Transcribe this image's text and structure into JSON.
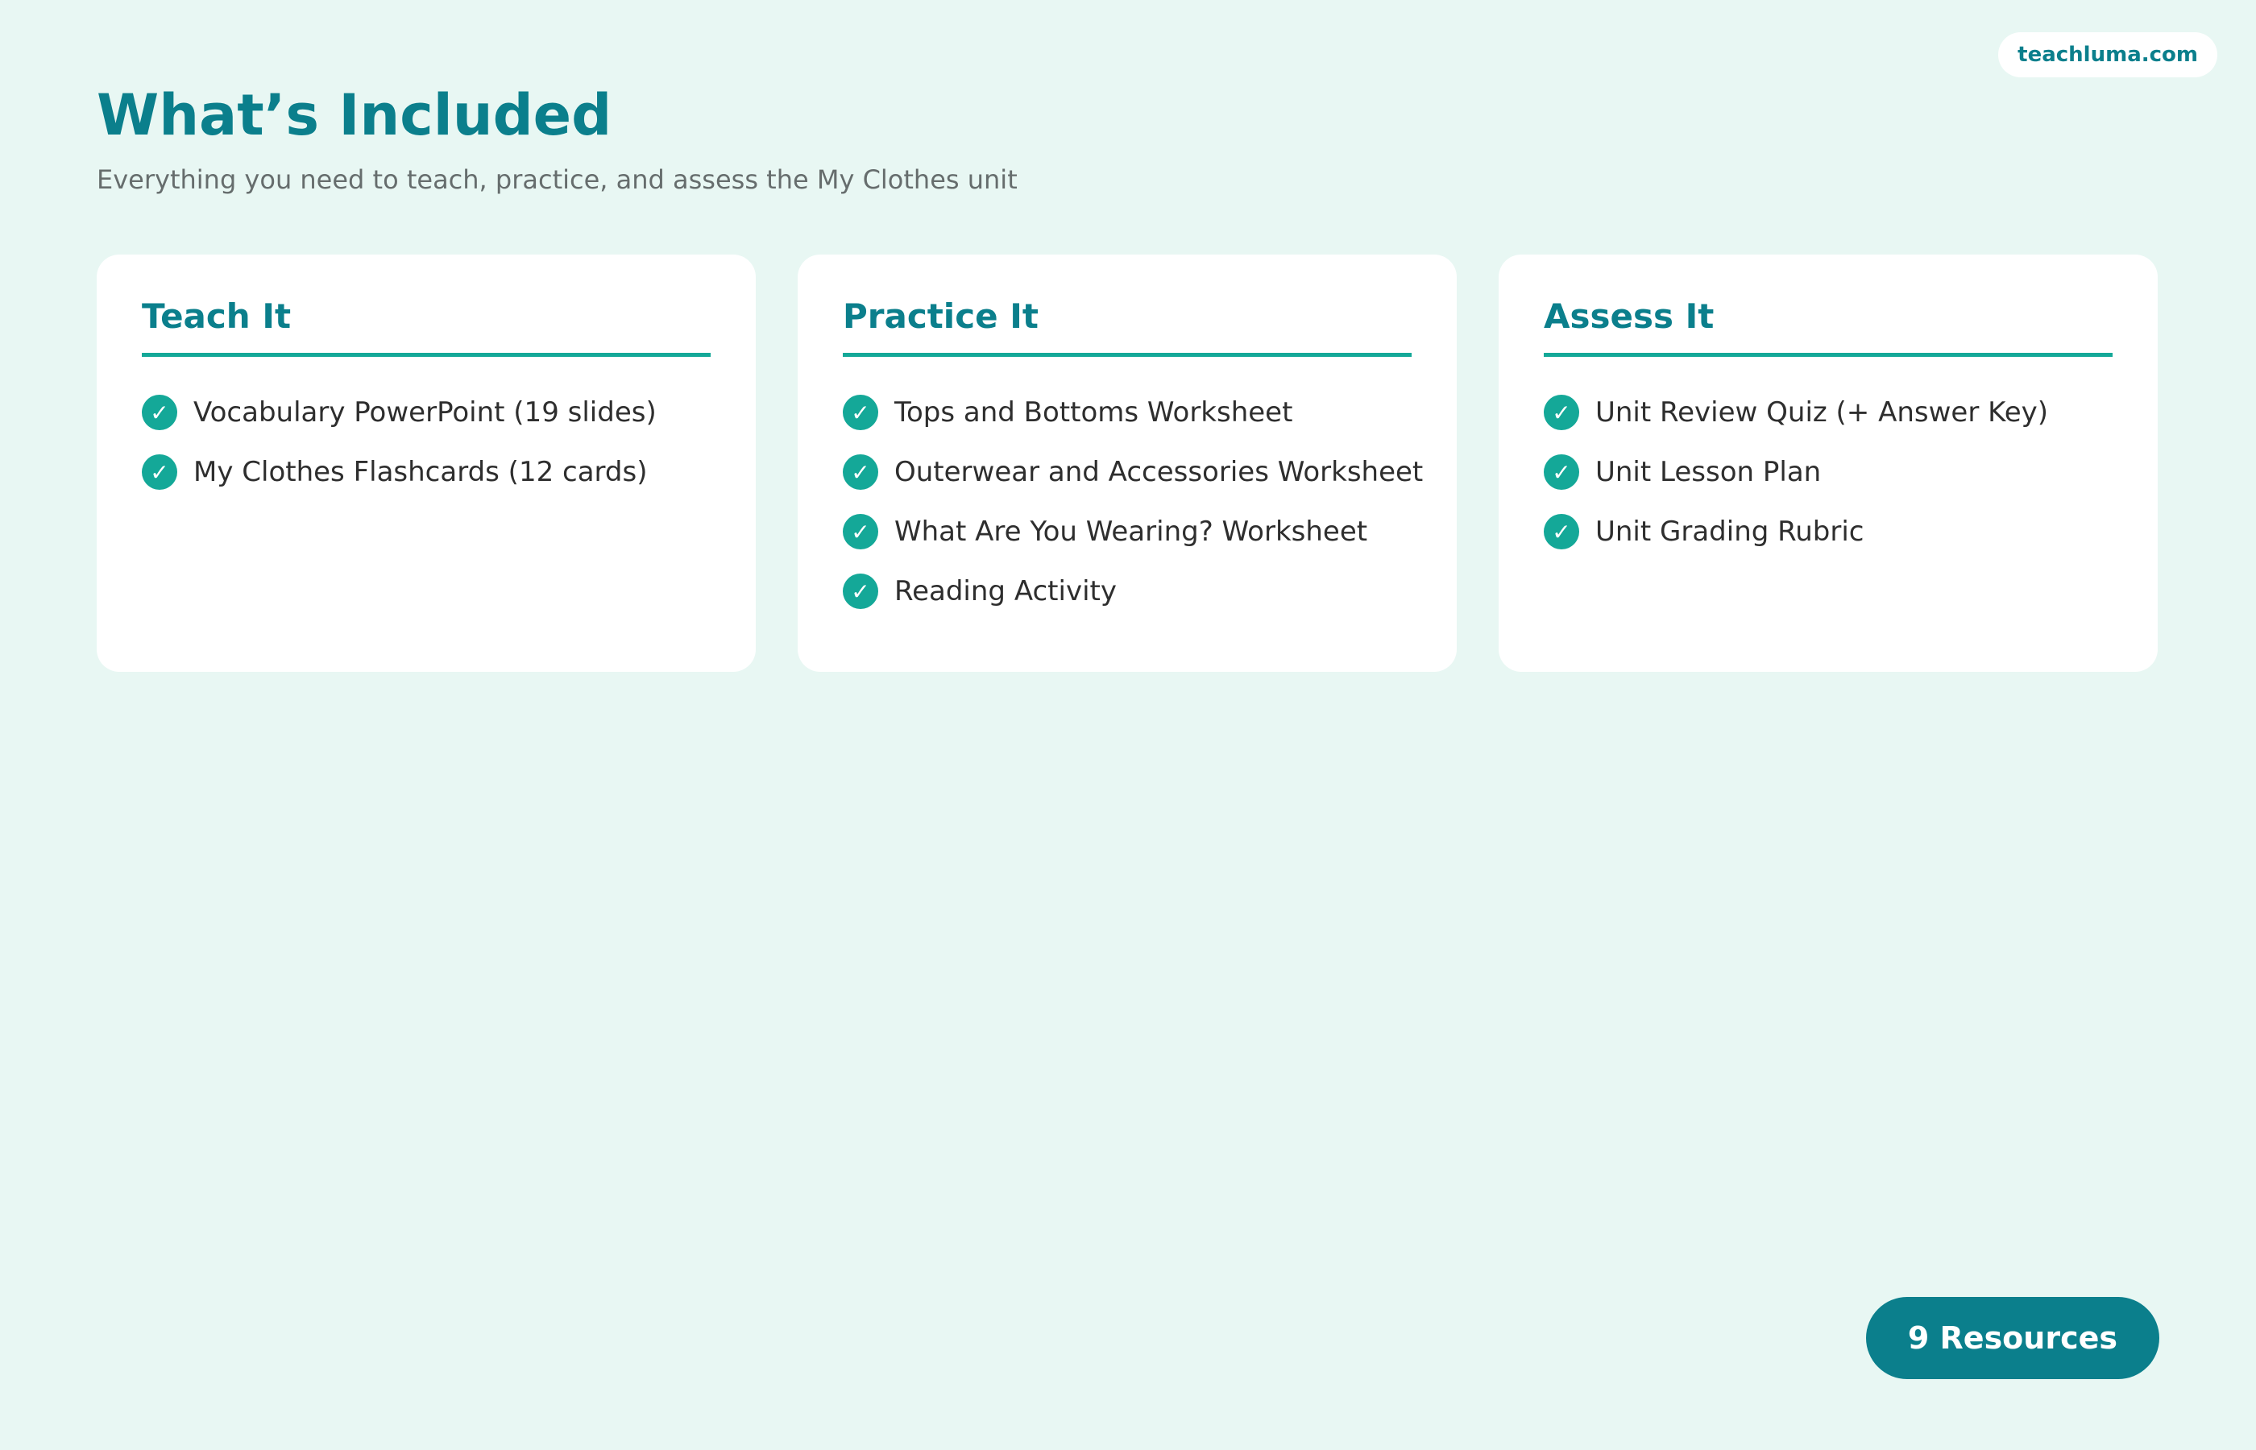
{
  "brand": {
    "url_label": "teachluma.com"
  },
  "header": {
    "title": "What’s Included",
    "subtitle": "Everything you need to teach, practice, and assess the My Clothes unit"
  },
  "cards": [
    {
      "title": "Teach It",
      "items": [
        "Vocabulary PowerPoint (19 slides)",
        "My Clothes Flashcards (12 cards)"
      ]
    },
    {
      "title": "Practice It",
      "items": [
        "Tops and Bottoms Worksheet",
        "Outerwear and Accessories Worksheet",
        "What Are You Wearing? Worksheet",
        "Reading Activity"
      ]
    },
    {
      "title": "Assess It",
      "items": [
        "Unit Review Quiz (+ Answer Key)",
        "Unit Lesson Plan",
        "Unit Grading Rubric"
      ]
    }
  ],
  "badge": {
    "label": "9 Resources"
  },
  "icons": {
    "check": "check-circle-icon"
  },
  "colors": {
    "accent": "#0b7f8c",
    "check": "#14a898",
    "background": "#e8f7f3",
    "card": "#ffffff"
  }
}
